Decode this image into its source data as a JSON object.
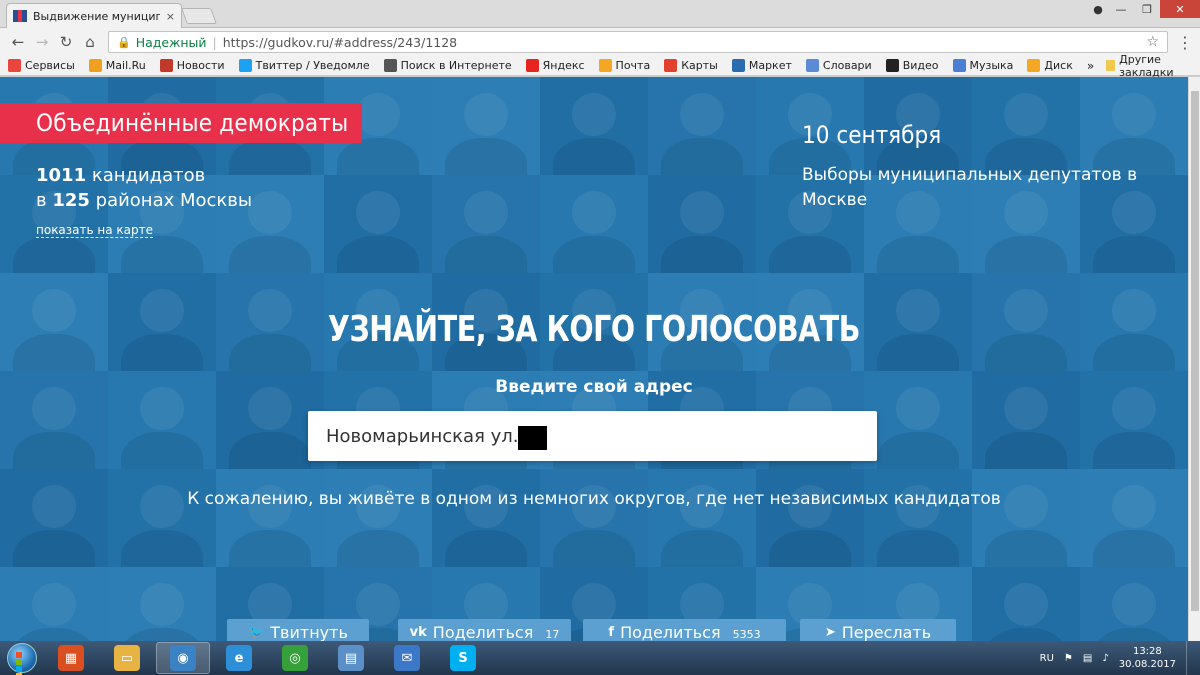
{
  "browser": {
    "tab_title": "Выдвижение муниципа",
    "tab_close": "×",
    "secure_label": "Надежный",
    "url": "https://gudkov.ru/#address/243/1128",
    "bookmarks": [
      {
        "label": "Сервисы",
        "icon": "apps-icon",
        "color": "#e8453c"
      },
      {
        "label": "Mail.Ru",
        "icon": "mailru-icon",
        "color": "#f0a020"
      },
      {
        "label": "Новости",
        "icon": "news-icon",
        "color": "#c0392b"
      },
      {
        "label": "Твиттер / Уведомле",
        "icon": "twitter-icon",
        "color": "#1da1f2"
      },
      {
        "label": "Поиск в Интернете",
        "icon": "search-icon",
        "color": "#555555"
      },
      {
        "label": "Яндекс",
        "icon": "yandex-icon",
        "color": "#e52620"
      },
      {
        "label": "Почта",
        "icon": "mail-icon",
        "color": "#f5a623"
      },
      {
        "label": "Карты",
        "icon": "maps-icon",
        "color": "#e0402c"
      },
      {
        "label": "Маркет",
        "icon": "market-icon",
        "color": "#2b6cb0"
      },
      {
        "label": "Словари",
        "icon": "dictionary-icon",
        "color": "#5b8ad6"
      },
      {
        "label": "Видео",
        "icon": "video-icon",
        "color": "#222222"
      },
      {
        "label": "Музыка",
        "icon": "music-icon",
        "color": "#4a7fd1"
      },
      {
        "label": "Диск",
        "icon": "disk-icon",
        "color": "#f5a623"
      }
    ],
    "more": "»",
    "other_bookmarks": "Другие закладки"
  },
  "page": {
    "brand": "Объединённые демократы",
    "count_line1_num": "1011",
    "count_line1_text": " кандидатов",
    "count_line2_pre": "в ",
    "count_line2_num": "125",
    "count_line2_text": " районах Москвы",
    "map_link": "показать на карте",
    "date": "10 сентября",
    "elections": "Выборы муниципальных депутатов в Москве",
    "headline": "УЗНАЙТЕ, ЗА КОГО ГОЛОСОВАТЬ",
    "prompt": "Введите свой адрес",
    "address_value": "Новомарьинская ул.",
    "notice": "К сожалению, вы живёте в одном из немногих округов, где нет независимых кандидатов",
    "share": [
      {
        "label": "Твитнуть",
        "count": "",
        "icon": "twitter-icon",
        "glyph": "🐦"
      },
      {
        "label": "Поделиться",
        "count": "17",
        "icon": "vk-icon",
        "glyph": "vk"
      },
      {
        "label": "Поделиться",
        "count": "5353",
        "icon": "facebook-icon",
        "glyph": "f"
      },
      {
        "label": "Переслать",
        "count": "",
        "icon": "telegram-icon",
        "glyph": "➤"
      }
    ]
  },
  "colors": {
    "brand_red": "#e8304a",
    "page_blue": "#2f7db4",
    "share_blue": "#5c9fd1"
  },
  "taskbar": {
    "apps": [
      {
        "icon": "windows-flag-icon",
        "color": "#d94f1f",
        "glyph": "▦"
      },
      {
        "icon": "file-explorer-icon",
        "color": "#e7b342",
        "glyph": "▭"
      },
      {
        "icon": "chrome-icon",
        "color": "#3b82c4",
        "glyph": "◉",
        "active": true
      },
      {
        "icon": "internet-explorer-icon",
        "color": "#2d8fd8",
        "glyph": "e"
      },
      {
        "icon": "network-icon",
        "color": "#36a03a",
        "glyph": "◎"
      },
      {
        "icon": "control-panel-icon",
        "color": "#5a8fc8",
        "glyph": "▤"
      },
      {
        "icon": "mail-app-icon",
        "color": "#3c78c8",
        "glyph": "✉"
      },
      {
        "icon": "skype-icon",
        "color": "#00aff0",
        "glyph": "S"
      }
    ],
    "language": "RU",
    "time": "13:28",
    "date": "30.08.2017"
  }
}
